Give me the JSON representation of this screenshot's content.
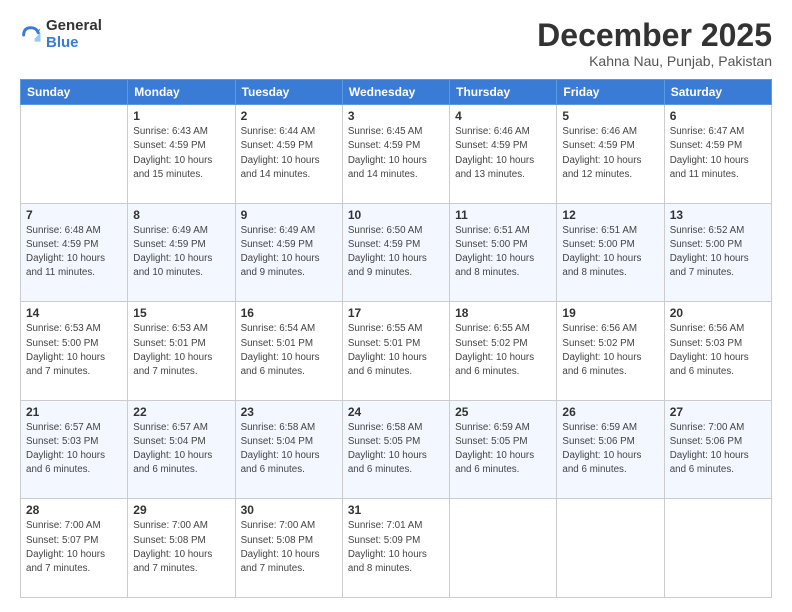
{
  "header": {
    "logo": {
      "general": "General",
      "blue": "Blue"
    },
    "title": "December 2025",
    "location": "Kahna Nau, Punjab, Pakistan"
  },
  "days_of_week": [
    "Sunday",
    "Monday",
    "Tuesday",
    "Wednesday",
    "Thursday",
    "Friday",
    "Saturday"
  ],
  "weeks": [
    [
      {
        "day": "",
        "info": ""
      },
      {
        "day": "1",
        "info": "Sunrise: 6:43 AM\nSunset: 4:59 PM\nDaylight: 10 hours\nand 15 minutes."
      },
      {
        "day": "2",
        "info": "Sunrise: 6:44 AM\nSunset: 4:59 PM\nDaylight: 10 hours\nand 14 minutes."
      },
      {
        "day": "3",
        "info": "Sunrise: 6:45 AM\nSunset: 4:59 PM\nDaylight: 10 hours\nand 14 minutes."
      },
      {
        "day": "4",
        "info": "Sunrise: 6:46 AM\nSunset: 4:59 PM\nDaylight: 10 hours\nand 13 minutes."
      },
      {
        "day": "5",
        "info": "Sunrise: 6:46 AM\nSunset: 4:59 PM\nDaylight: 10 hours\nand 12 minutes."
      },
      {
        "day": "6",
        "info": "Sunrise: 6:47 AM\nSunset: 4:59 PM\nDaylight: 10 hours\nand 11 minutes."
      }
    ],
    [
      {
        "day": "7",
        "info": "Sunrise: 6:48 AM\nSunset: 4:59 PM\nDaylight: 10 hours\nand 11 minutes."
      },
      {
        "day": "8",
        "info": "Sunrise: 6:49 AM\nSunset: 4:59 PM\nDaylight: 10 hours\nand 10 minutes."
      },
      {
        "day": "9",
        "info": "Sunrise: 6:49 AM\nSunset: 4:59 PM\nDaylight: 10 hours\nand 9 minutes."
      },
      {
        "day": "10",
        "info": "Sunrise: 6:50 AM\nSunset: 4:59 PM\nDaylight: 10 hours\nand 9 minutes."
      },
      {
        "day": "11",
        "info": "Sunrise: 6:51 AM\nSunset: 5:00 PM\nDaylight: 10 hours\nand 8 minutes."
      },
      {
        "day": "12",
        "info": "Sunrise: 6:51 AM\nSunset: 5:00 PM\nDaylight: 10 hours\nand 8 minutes."
      },
      {
        "day": "13",
        "info": "Sunrise: 6:52 AM\nSunset: 5:00 PM\nDaylight: 10 hours\nand 7 minutes."
      }
    ],
    [
      {
        "day": "14",
        "info": "Sunrise: 6:53 AM\nSunset: 5:00 PM\nDaylight: 10 hours\nand 7 minutes."
      },
      {
        "day": "15",
        "info": "Sunrise: 6:53 AM\nSunset: 5:01 PM\nDaylight: 10 hours\nand 7 minutes."
      },
      {
        "day": "16",
        "info": "Sunrise: 6:54 AM\nSunset: 5:01 PM\nDaylight: 10 hours\nand 6 minutes."
      },
      {
        "day": "17",
        "info": "Sunrise: 6:55 AM\nSunset: 5:01 PM\nDaylight: 10 hours\nand 6 minutes."
      },
      {
        "day": "18",
        "info": "Sunrise: 6:55 AM\nSunset: 5:02 PM\nDaylight: 10 hours\nand 6 minutes."
      },
      {
        "day": "19",
        "info": "Sunrise: 6:56 AM\nSunset: 5:02 PM\nDaylight: 10 hours\nand 6 minutes."
      },
      {
        "day": "20",
        "info": "Sunrise: 6:56 AM\nSunset: 5:03 PM\nDaylight: 10 hours\nand 6 minutes."
      }
    ],
    [
      {
        "day": "21",
        "info": "Sunrise: 6:57 AM\nSunset: 5:03 PM\nDaylight: 10 hours\nand 6 minutes."
      },
      {
        "day": "22",
        "info": "Sunrise: 6:57 AM\nSunset: 5:04 PM\nDaylight: 10 hours\nand 6 minutes."
      },
      {
        "day": "23",
        "info": "Sunrise: 6:58 AM\nSunset: 5:04 PM\nDaylight: 10 hours\nand 6 minutes."
      },
      {
        "day": "24",
        "info": "Sunrise: 6:58 AM\nSunset: 5:05 PM\nDaylight: 10 hours\nand 6 minutes."
      },
      {
        "day": "25",
        "info": "Sunrise: 6:59 AM\nSunset: 5:05 PM\nDaylight: 10 hours\nand 6 minutes."
      },
      {
        "day": "26",
        "info": "Sunrise: 6:59 AM\nSunset: 5:06 PM\nDaylight: 10 hours\nand 6 minutes."
      },
      {
        "day": "27",
        "info": "Sunrise: 7:00 AM\nSunset: 5:06 PM\nDaylight: 10 hours\nand 6 minutes."
      }
    ],
    [
      {
        "day": "28",
        "info": "Sunrise: 7:00 AM\nSunset: 5:07 PM\nDaylight: 10 hours\nand 7 minutes."
      },
      {
        "day": "29",
        "info": "Sunrise: 7:00 AM\nSunset: 5:08 PM\nDaylight: 10 hours\nand 7 minutes."
      },
      {
        "day": "30",
        "info": "Sunrise: 7:00 AM\nSunset: 5:08 PM\nDaylight: 10 hours\nand 7 minutes."
      },
      {
        "day": "31",
        "info": "Sunrise: 7:01 AM\nSunset: 5:09 PM\nDaylight: 10 hours\nand 8 minutes."
      },
      {
        "day": "",
        "info": ""
      },
      {
        "day": "",
        "info": ""
      },
      {
        "day": "",
        "info": ""
      }
    ]
  ]
}
